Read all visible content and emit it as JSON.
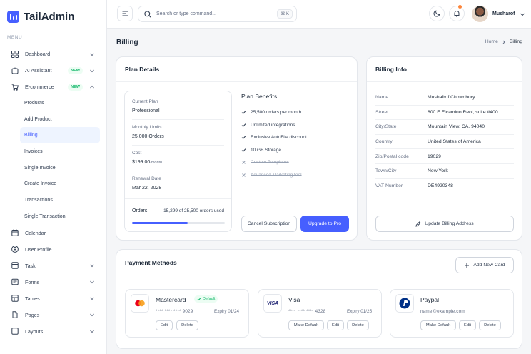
{
  "brand": {
    "name": "TailAdmin",
    "accent": "#465fff"
  },
  "sidebar": {
    "menu_caption": "MENU",
    "items": [
      {
        "label": "Dashboard",
        "icon": "grid-icon",
        "chevron": true
      },
      {
        "label": "AI Assistant",
        "icon": "ai-icon",
        "badge": "NEW",
        "chevron": true
      },
      {
        "label": "E-commerce",
        "icon": "cart-icon",
        "badge": "NEW",
        "chevron": true,
        "expanded": true
      }
    ],
    "sub_items": [
      "Products",
      "Add Product",
      "Billing",
      "Invoices",
      "Single Invoice",
      "Create Invoice",
      "Transactions",
      "Single Transaction"
    ],
    "active_sub": "Billing",
    "items_after": [
      {
        "label": "Calendar",
        "icon": "calendar-icon"
      },
      {
        "label": "User Profile",
        "icon": "user-icon"
      },
      {
        "label": "Task",
        "icon": "task-icon",
        "chevron": true
      },
      {
        "label": "Forms",
        "icon": "forms-icon",
        "chevron": true
      },
      {
        "label": "Tables",
        "icon": "table-icon",
        "chevron": true
      },
      {
        "label": "Pages",
        "icon": "pages-icon",
        "chevron": true
      },
      {
        "label": "Layouts",
        "icon": "layouts-icon",
        "chevron": true
      }
    ]
  },
  "header": {
    "search_placeholder": "Search or type command...",
    "search_shortcut": "⌘ K",
    "user_name": "Musharof"
  },
  "page": {
    "title": "Billing",
    "breadcrumb_home": "Home",
    "breadcrumb_current": "Billing"
  },
  "plan_details": {
    "title": "Plan Details",
    "current_plan_label": "Current Plan",
    "current_plan_value": "Professional",
    "monthly_limits_label": "Monthly Limits",
    "monthly_limits_value": "25,000 Orders",
    "cost_label": "Cost",
    "cost_value": "$199.00",
    "cost_period": "/month",
    "renewal_label": "Renewal Date",
    "renewal_value": "Mar 22, 2028",
    "orders_label": "Orders",
    "orders_usage": "15,299 of 25,500 orders used",
    "orders_fraction": 0.6,
    "benefits_title": "Plan Benefits",
    "benefits": [
      {
        "text": "25,500 orders per month",
        "included": true
      },
      {
        "text": "Unlimited integrations",
        "included": true
      },
      {
        "text": "Exclusive AutoFile discount",
        "included": true
      },
      {
        "text": "10 GB Storage",
        "included": true
      },
      {
        "text": "Custom Templates",
        "included": false
      },
      {
        "text": "Advanced Marketing tool",
        "included": false
      }
    ],
    "cancel_label": "Cancel Subscription",
    "upgrade_label": "Upgrade to Pro"
  },
  "billing_info": {
    "title": "Billing Info",
    "rows": [
      {
        "key": "Name",
        "value": "Mushafrof Chowdhury"
      },
      {
        "key": "Street",
        "value": "800 E Elcamino Reol, suite #400"
      },
      {
        "key": "City/State",
        "value": "Mountain View, CA, 94040"
      },
      {
        "key": "Country",
        "value": "United States of America"
      },
      {
        "key": "Zip/Postal code",
        "value": "19029"
      },
      {
        "key": "Town/City",
        "value": "New York"
      },
      {
        "key": "VAT Number",
        "value": "DE4920348"
      }
    ],
    "update_label": "Update Billing Address"
  },
  "payment_methods": {
    "title": "Payment Methods",
    "add_label": "Add New Card",
    "cards": [
      {
        "name": "Mastercard",
        "default_badge": "Default",
        "number": "**** **** **** 9029",
        "expiry": "Expiry 01/24",
        "logo": "mastercard-logo",
        "buttons": [
          "Edit",
          "Delete"
        ]
      },
      {
        "name": "Visa",
        "number": "**** **** **** 4328",
        "expiry": "Expiry 01/25",
        "logo": "visa-logo",
        "logo_text": "VISA",
        "buttons": [
          "Make Default",
          "Edit",
          "Delete"
        ]
      },
      {
        "name": "Paypal",
        "email": "name@example.com",
        "logo": "paypal-logo",
        "buttons": [
          "Make Default",
          "Edit",
          "Delete"
        ]
      }
    ]
  }
}
